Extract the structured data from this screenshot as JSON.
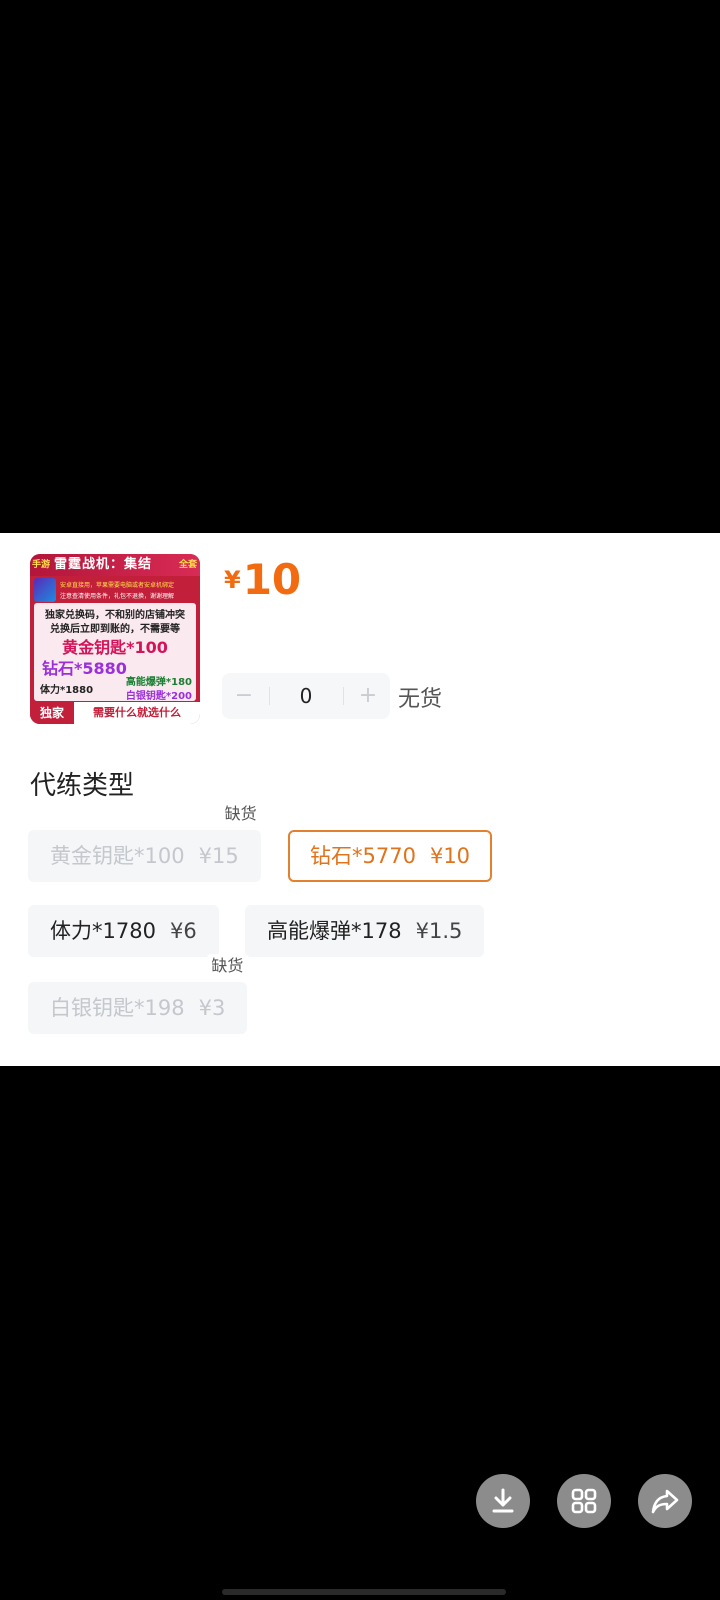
{
  "product": {
    "image": {
      "header_tag": "手游",
      "header_title": "雷霆战机：集结",
      "header_suffix": "全套",
      "sub_line_1": "安卓直接用，苹果需要电脑或者安卓机绑定",
      "sub_line_2": "注意查清使用条件，礼包不退换，谢谢理解",
      "line_1": "独家兑换码，不和别的店铺冲突",
      "line_2": "兑换后立即到账的，不需要等",
      "gold_keys": "黄金钥匙*100",
      "diamonds": "钻石*5880",
      "stamina": "体力*1880",
      "bombs": "高能爆弹*180",
      "silver_keys": "白银钥匙*200",
      "footer_tag": "独家",
      "footer_text": "需要什么就选什么"
    },
    "price_symbol": "¥",
    "price_value": "10"
  },
  "quantity": {
    "minus": "−",
    "value": "0",
    "plus": "+",
    "stock_status": "无货"
  },
  "options_section": {
    "title": "代练类型",
    "sold_out_label": "缺货",
    "items": [
      {
        "name": "黄金钥匙*100",
        "price": "¥15",
        "state": "sold_out"
      },
      {
        "name": "钻石*5770",
        "price": "¥10",
        "state": "selected"
      },
      {
        "name": "体力*1780",
        "price": "¥6",
        "state": "normal"
      },
      {
        "name": "高能爆弹*178",
        "price": "¥1.5",
        "state": "normal"
      },
      {
        "name": "白银钥匙*198",
        "price": "¥3",
        "state": "sold_out"
      }
    ]
  },
  "floating_actions": [
    {
      "icon": "download-icon"
    },
    {
      "icon": "grid-icon"
    },
    {
      "icon": "share-icon"
    }
  ],
  "colors": {
    "accent": "#f26b10",
    "selected_border": "#e4812f",
    "chip_bg": "#f5f6f8"
  }
}
